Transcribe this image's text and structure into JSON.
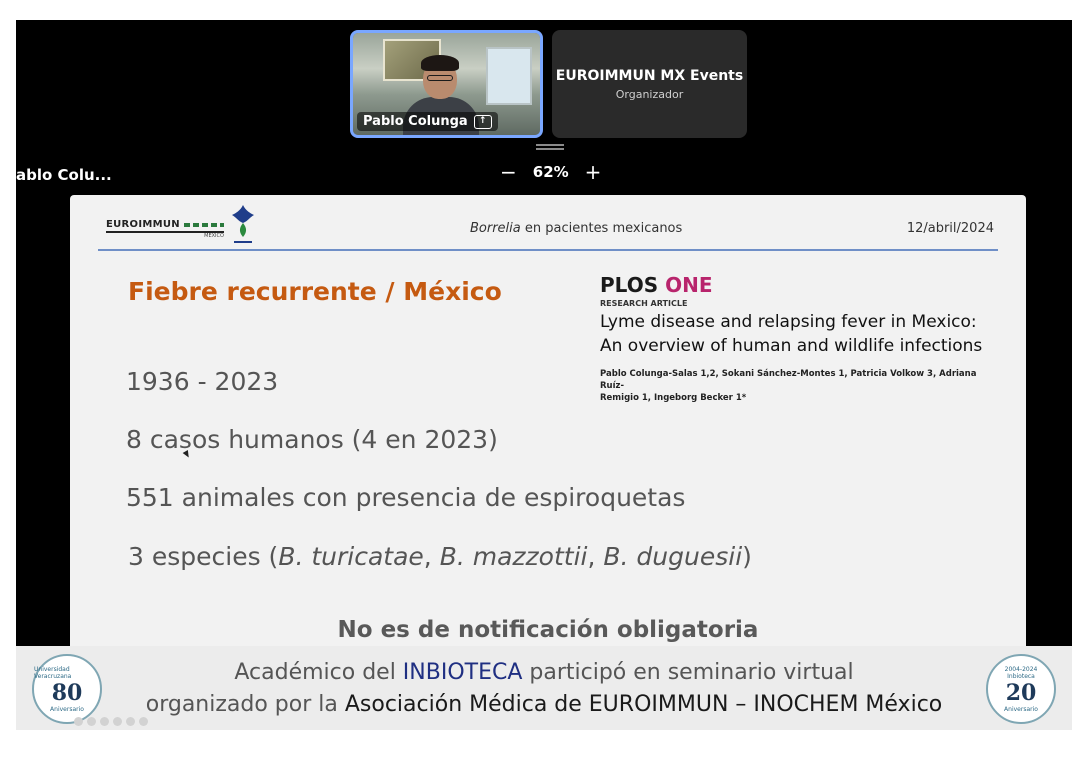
{
  "meeting": {
    "participants": [
      {
        "name": "Pablo Colunga"
      },
      {
        "name": "EUROIMMUN MX Events",
        "role": "Organizador"
      }
    ],
    "active_speaker_label": "ablo Colu...",
    "zoom": {
      "minus": "−",
      "value": "62%",
      "plus": "+"
    }
  },
  "slide": {
    "logo_left": {
      "brand": "EUROIMMUN",
      "sub": "MEXICO"
    },
    "topic_italic": "Borrelia",
    "topic_rest": " en pacientes mexicanos",
    "date": "12/abril/2024",
    "title": "Fiebre recurrente / México",
    "bullets": {
      "b1": "1936 - 2023",
      "b2": "8 casos humanos (4 en 2023)",
      "b3": "551 animales con presencia de espiroquetas",
      "b4_pre": "3 especies (",
      "b4_s1": "B. turicatae",
      "b4_sep1": ", ",
      "b4_s2": "B. mazzottii",
      "b4_sep2": ", ",
      "b4_s3": "B. duguesii",
      "b4_post": ")"
    },
    "footer": "No es de notificación obligatoria",
    "article": {
      "journal_a": "PLOS",
      "journal_b": " ONE",
      "kind": "RESEARCH ARTICLE",
      "title_line1": "Lyme disease and relapsing fever in Mexico:",
      "title_line2": "An overview of human and wildlife infections",
      "authors_line1": "Pablo Colunga-Salas 1,2, Sokani Sánchez-Montes 1, Patricia Volkow 3, Adriana Ruíz-",
      "authors_line2": "Remigio 1, Ingeborg Becker 1*"
    }
  },
  "banner": {
    "line1_a": "Académico del ",
    "line1_hl": "INBIOTECA",
    "line1_b": " participó en seminario virtual",
    "line2_a": "organizado por la ",
    "line2_dark": "Asociación Médica de EUROIMMUN – INOCHEM México",
    "seal_left": {
      "ring": "Universidad Veracruzana",
      "num": "80",
      "bottom": "Aniversario"
    },
    "seal_right": {
      "ring": "2004-2024",
      "brand": "Inbioteca",
      "num": "20",
      "bottom": "Aniversario"
    }
  },
  "colors": {
    "slide_title": "#c55a11",
    "active_tile_border": "#7aa7ff",
    "plos_one": "#b8246c",
    "banner_highlight": "#1f2f82"
  }
}
